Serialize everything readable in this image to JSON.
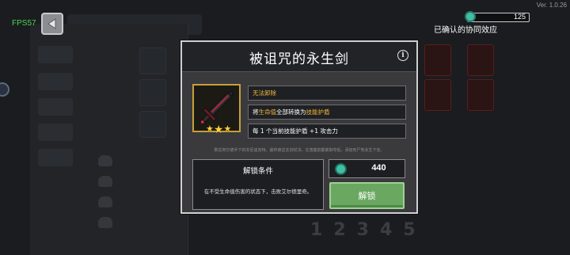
{
  "hud": {
    "fps": "FPS57",
    "version": "Ver. 1.0.26",
    "gem_count": "125",
    "synergy_label": "已确认的协同效应"
  },
  "dialog": {
    "title": "被诅咒的永生剑",
    "info_icon": "info-icon",
    "weapon": {
      "icon": "cursed-sword-icon",
      "stars": 3
    },
    "traits": {
      "t1": "无法卸除",
      "t2_prefix": "将",
      "t2_hl1": "生命值",
      "t2_mid": "全部转换为",
      "t2_hl2": "技能护盾",
      "t3": "每 1 个当前技能护盾 +1 攻击力"
    },
    "flavor_text": "数在阿尔德手下的本尼迪克特。最终被这支剑杖决。在落塞前都被剥夺后，添加死尸地永生下去。",
    "unlock": {
      "title": "解锁条件",
      "condition": "在不受生命值伤害的状态下，击败艾尔德里奇。"
    },
    "cost": {
      "icon": "gem-icon",
      "value": "440"
    },
    "unlock_button": "解锁"
  },
  "background": {
    "digits": [
      "1",
      "2",
      "3",
      "4",
      "5"
    ]
  },
  "colors": {
    "accent_gold": "#f0b93a",
    "button_green": "#6aa862",
    "fps_green": "#4fd34f",
    "gem_teal": "#3fbfa3"
  }
}
